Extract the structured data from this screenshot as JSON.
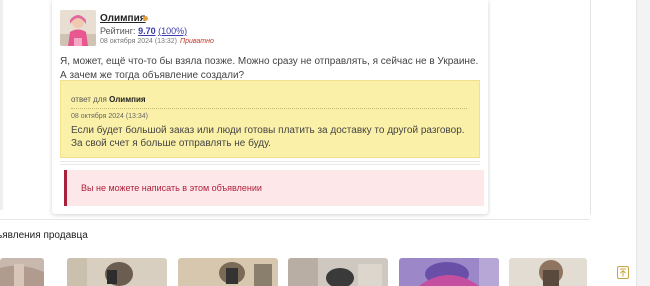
{
  "post": {
    "username": "Олимпия",
    "rating_label": "Рейтинг:",
    "rating_value": "9.70",
    "rating_percent": "(100%)",
    "date": "08 октября 2024 (13:32)",
    "private_label": "Приватно",
    "message_line1": "Я, может, ещё что-то бы взяла позже. Можно сразу не отправлять, я сейчас не в Украине.",
    "message_line2": "А зачем же тогда объявление создали?",
    "online_color": "#e8a13a"
  },
  "reply": {
    "prefix": "ответ для",
    "to_user": "Олимпия",
    "date": "08 октября 2024 (13:34)",
    "line1": "Если будет большой заказ или люди готовы платить за доставку то другой разговор.",
    "line2": "За свой счет я больше отправлять не буду."
  },
  "notice": {
    "text": "Вы не можете написать в этом объявлении"
  },
  "seller_section": {
    "title": "ъявления продавца"
  },
  "icons": {
    "scroll_top": "arrow-up-to-top-icon",
    "online": "online-dot-icon"
  }
}
